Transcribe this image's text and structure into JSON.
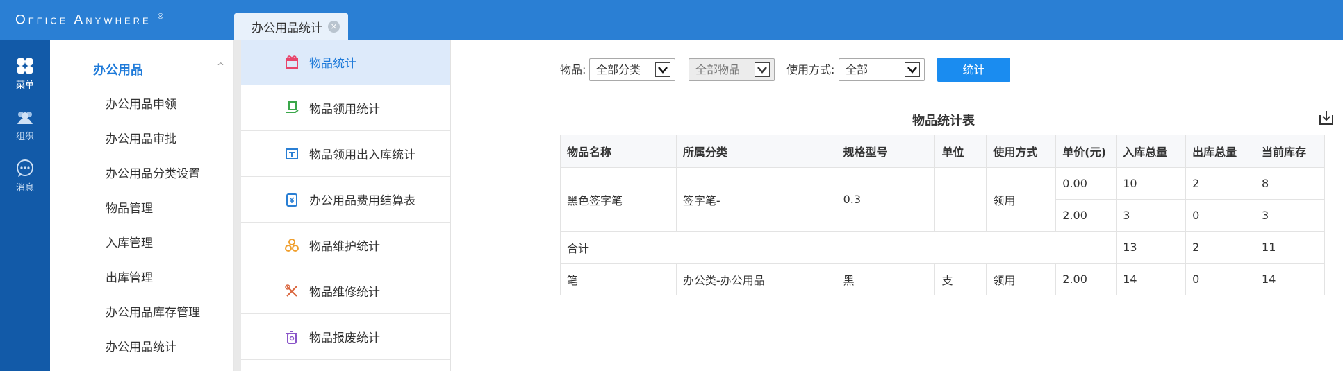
{
  "header": {
    "logo": "Office Anywhere",
    "logo_mark": "®",
    "tab_label": "办公用品统计",
    "tab_close": "×"
  },
  "iconbar": {
    "items": [
      {
        "label": "菜单",
        "icon": "grid-icon"
      },
      {
        "label": "组织",
        "icon": "users-icon"
      },
      {
        "label": "消息",
        "icon": "chat-icon"
      }
    ]
  },
  "menu": {
    "title": "办公用品",
    "caret": "^",
    "items": [
      "办公用品申领",
      "办公用品审批",
      "办公用品分类设置",
      "物品管理",
      "入库管理",
      "出库管理",
      "办公用品库存管理",
      "办公用品统计"
    ]
  },
  "panel2": {
    "items": [
      {
        "label": "物品统计",
        "icon": "gift-icon"
      },
      {
        "label": "物品领用统计",
        "icon": "hand-icon"
      },
      {
        "label": "物品领用出入库统计",
        "icon": "box-icon"
      },
      {
        "label": "办公用品费用结算表",
        "icon": "clipboard-icon"
      },
      {
        "label": "物品维护统计",
        "icon": "circles-icon"
      },
      {
        "label": "物品维修统计",
        "icon": "tools-icon"
      },
      {
        "label": "物品报废统计",
        "icon": "trash-icon"
      }
    ]
  },
  "filters": {
    "item_label": "物品:",
    "category_value": "全部分类",
    "item_value": "全部物品",
    "usage_label": "使用方式:",
    "usage_value": "全部",
    "submit": "统计"
  },
  "table": {
    "title": "物品统计表",
    "headers": [
      "物品名称",
      "所属分类",
      "规格型号",
      "单位",
      "使用方式",
      "单价(元)",
      "入库总量",
      "出库总量",
      "当前库存"
    ],
    "group": {
      "name": "黑色签字笔",
      "category": "签字笔-",
      "spec": "0.3",
      "unit": "",
      "usage": "领用",
      "rows": [
        {
          "price": "0.00",
          "in": "10",
          "out": "2",
          "stock": "8"
        },
        {
          "price": "2.00",
          "in": "3",
          "out": "0",
          "stock": "3"
        }
      ]
    },
    "subtotal": {
      "label": "合计",
      "in": "13",
      "out": "2",
      "stock": "11"
    },
    "row2": {
      "name": "笔",
      "category": "办公类-办公用品",
      "spec": "黑",
      "unit": "支",
      "usage": "领用",
      "price": "2.00",
      "in": "14",
      "out": "0",
      "stock": "14"
    }
  }
}
